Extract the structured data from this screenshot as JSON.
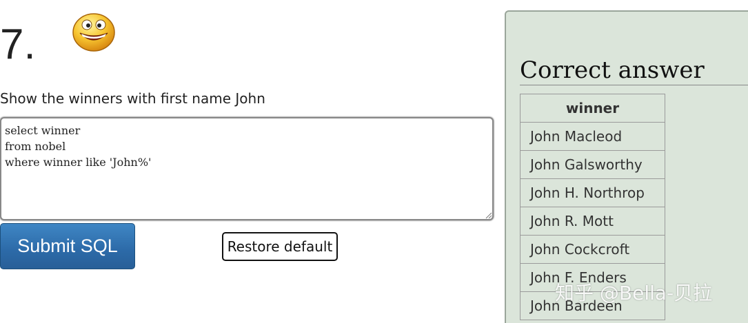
{
  "question": {
    "number": "7.",
    "text": "Show the winners with first name John",
    "emoji_icon": "grinning-smiley-icon"
  },
  "editor": {
    "sql": "select winner\nfrom nobel\nwhere winner like 'John%'"
  },
  "buttons": {
    "submit_label": "Submit SQL",
    "restore_label": "Restore default"
  },
  "answer": {
    "heading": "Correct answer",
    "column_header": "winner",
    "rows": [
      "John Macleod",
      "John Galsworthy",
      "John H. Northrop",
      "John R. Mott",
      "John Cockcroft",
      "John F. Enders",
      "John Bardeen"
    ]
  },
  "watermark": "知乎 @Bella-贝拉",
  "colors": {
    "submit_bg": "#2c6aa8",
    "panel_bg": "#dbe5da"
  }
}
